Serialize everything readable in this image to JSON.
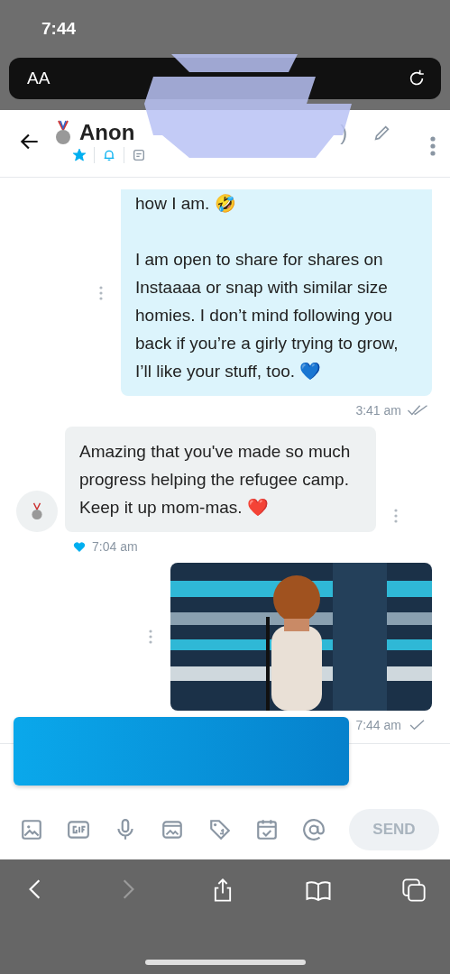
{
  "status_bar": {
    "time": "7:44"
  },
  "browser": {
    "text_size_button": "AA"
  },
  "header": {
    "title": "Anon",
    "title_end": ")",
    "starred": true,
    "notifications_on": true
  },
  "messages": [
    {
      "kind": "sent_text",
      "paragraphs": [
        "how I am. 🤣",
        "I am open to share for shares on Instaaaa or snap with similar size homies. I don’t mind following you back if you’re a girly trying to grow, I’ll like your stuff, too. 💙"
      ],
      "time": "3:41 am",
      "read": true
    },
    {
      "kind": "received_text",
      "paragraphs": [
        "Amazing that you've made so much progress helping the refugee camp. Keep it up mom-mas. ❤️"
      ],
      "time": "7:04 am",
      "liked": true
    },
    {
      "kind": "sent_image",
      "time": "7:44 am",
      "read": false
    }
  ],
  "composer": {
    "send_label": "SEND",
    "send_disabled": true
  }
}
